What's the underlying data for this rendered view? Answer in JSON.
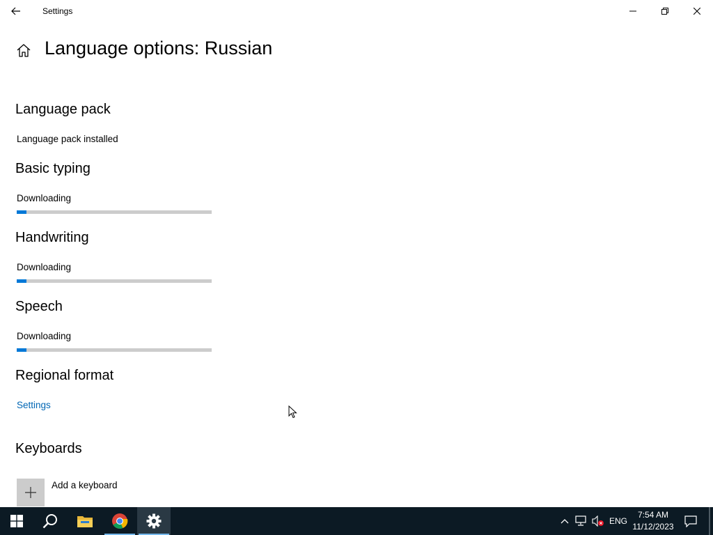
{
  "window": {
    "app_title": "Settings"
  },
  "page": {
    "title": "Language options: Russian"
  },
  "sections": {
    "language_pack": {
      "title": "Language pack",
      "status": "Language pack installed"
    },
    "basic_typing": {
      "title": "Basic typing",
      "status": "Downloading",
      "progress": 0.05
    },
    "handwriting": {
      "title": "Handwriting",
      "status": "Downloading",
      "progress": 0.05
    },
    "speech": {
      "title": "Speech",
      "status": "Downloading",
      "progress": 0.05
    },
    "regional_format": {
      "title": "Regional format",
      "link": "Settings"
    },
    "keyboards": {
      "title": "Keyboards",
      "add_label": "Add a keyboard"
    }
  },
  "taskbar": {
    "items": [
      {
        "icon": "windows-start-icon"
      },
      {
        "icon": "search-icon"
      },
      {
        "icon": "file-explorer-icon"
      },
      {
        "icon": "chrome-icon"
      },
      {
        "icon": "settings-gear-icon",
        "active": true
      }
    ],
    "tray": {
      "language": "ENG",
      "time": "7:54 AM",
      "date": "11/12/2023"
    }
  },
  "colors": {
    "accent": "#0078d7",
    "link": "#0066b4",
    "progress_track": "#cccccc",
    "taskbar": "#0c1a24"
  }
}
